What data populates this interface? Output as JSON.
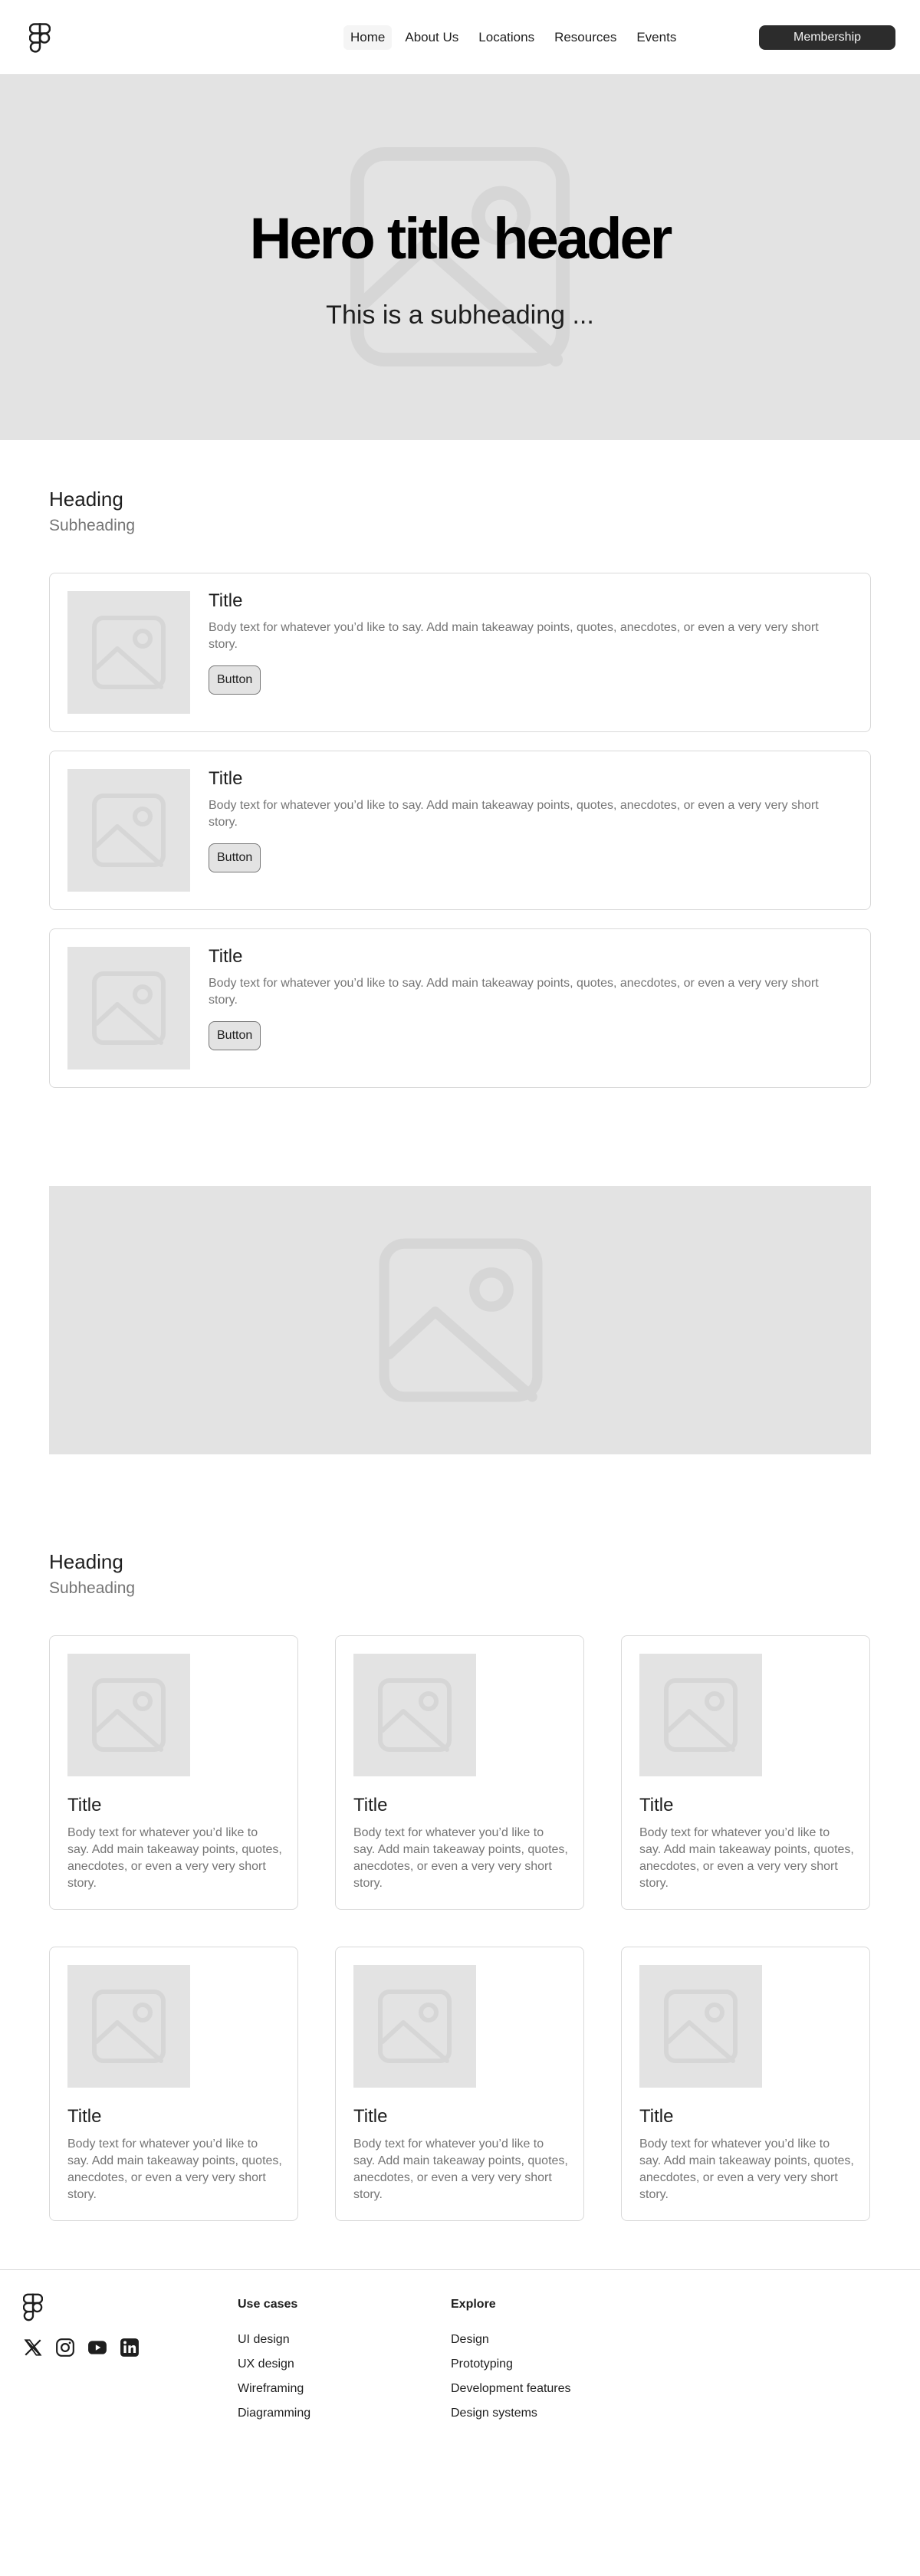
{
  "header": {
    "nav": [
      "Home",
      "About Us",
      "Locations",
      "Resources",
      "Events"
    ],
    "membership_label": "Membership"
  },
  "hero": {
    "title": "Hero title header",
    "subtitle": "This is a subheading ..."
  },
  "section1": {
    "heading": "Heading",
    "subheading": "Subheading",
    "cards": [
      {
        "title": "Title",
        "body": "Body text for whatever you’d like to say. Add main takeaway points, quotes, anecdotes, or even a very very short story.",
        "button": "Button"
      },
      {
        "title": "Title",
        "body": "Body text for whatever you’d like to say. Add main takeaway points, quotes, anecdotes, or even a very very short story.",
        "button": "Button"
      },
      {
        "title": "Title",
        "body": "Body text for whatever you’d like to say. Add main takeaway points, quotes, anecdotes, or even a very very short story.",
        "button": "Button"
      }
    ]
  },
  "section2": {
    "heading": "Heading",
    "subheading": "Subheading",
    "cards": [
      {
        "title": "Title",
        "body": "Body text for whatever you’d like to say. Add main takeaway points, quotes, anecdotes, or even a very very short story."
      },
      {
        "title": "Title",
        "body": "Body text for whatever you’d like to say. Add main takeaway points, quotes, anecdotes, or even a very very short story."
      },
      {
        "title": "Title",
        "body": "Body text for whatever you’d like to say. Add main takeaway points, quotes, anecdotes, or even a very very short story."
      },
      {
        "title": "Title",
        "body": "Body text for whatever you’d like to say. Add main takeaway points, quotes, anecdotes, or even a very very short story."
      },
      {
        "title": "Title",
        "body": "Body text for whatever you’d like to say. Add main takeaway points, quotes, anecdotes, or even a very very short story."
      },
      {
        "title": "Title",
        "body": "Body text for whatever you’d like to say. Add main takeaway points, quotes, anecdotes, or even a very very short story."
      }
    ]
  },
  "footer": {
    "socials": [
      "x-icon",
      "instagram-icon",
      "youtube-icon",
      "linkedin-icon"
    ],
    "columns": [
      {
        "title": "Use cases",
        "links": [
          "UI design",
          "UX design",
          "Wireframing",
          "Diagramming"
        ]
      },
      {
        "title": "Explore",
        "links": [
          "Design",
          "Prototyping",
          "Development features",
          "Design systems"
        ]
      }
    ]
  },
  "colors": {
    "placeholder_bg": "#e3e3e3",
    "dark_button": "#2c2c2c",
    "muted_text": "#757575",
    "border": "#d9d9d9"
  }
}
